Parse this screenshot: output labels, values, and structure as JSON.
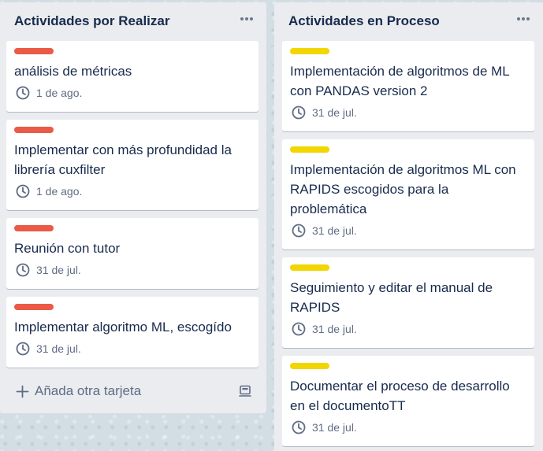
{
  "colors": {
    "red_label": "#eb5a46",
    "yellow_label": "#f2d600"
  },
  "lists": [
    {
      "title": "Actividades por Realizar",
      "add_card_label": "Añada otra tarjeta",
      "cards": [
        {
          "title": "análisis de métricas",
          "due": "1 de ago.",
          "label_color": "red"
        },
        {
          "title": "Implementar con más profundidad la librería cuxfilter",
          "due": "1 de ago.",
          "label_color": "red"
        },
        {
          "title": "Reunión con tutor",
          "due": "31 de jul.",
          "label_color": "red"
        },
        {
          "title": "Implementar algoritmo ML, escogído",
          "due": "31 de jul.",
          "label_color": "red"
        }
      ]
    },
    {
      "title": "Actividades en Proceso",
      "cards": [
        {
          "title": "Implementación de algoritmos de ML con PANDAS version 2",
          "due": "31 de jul.",
          "label_color": "yellow"
        },
        {
          "title": "Implementación de algoritmos ML con RAPIDS escogidos para la problemática",
          "due": "31 de jul.",
          "label_color": "yellow"
        },
        {
          "title": "Seguimiento y editar el manual de RAPIDS",
          "due": "31 de jul.",
          "label_color": "yellow"
        },
        {
          "title": "Documentar el proceso de desarrollo en el documentoTT",
          "due": "31 de jul.",
          "label_color": "yellow"
        }
      ]
    }
  ]
}
